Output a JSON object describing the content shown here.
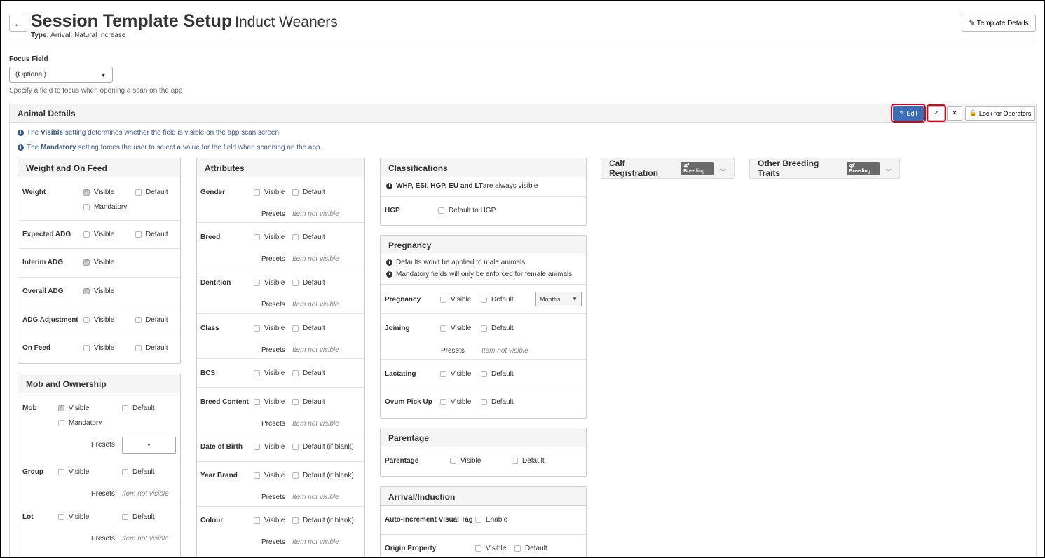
{
  "header": {
    "title": "Session Template Setup",
    "subtitle": "Induct Weaners",
    "type_label": "Type:",
    "type_value": "Arrival: Natural Increase",
    "template_details": "Template Details",
    "back": "←"
  },
  "focus": {
    "label": "Focus Field",
    "value": "(Optional)",
    "help": "Specify a field to focus when opening a scan on the app"
  },
  "panel": {
    "title": "Animal Details",
    "edit": "Edit",
    "lock": "Lock for Operators",
    "info1_pre": "The ",
    "info1_b": "Visible",
    "info1_post": " setting determines whether the field is visible on the app scan screen.",
    "info2_pre": "The ",
    "info2_b": "Mandatory",
    "info2_post": " setting forces the user to select a value for the field when scanning on the app."
  },
  "labels": {
    "visible": "Visible",
    "default": "Default",
    "mandatory": "Mandatory",
    "presets": "Presets",
    "item_not_visible": "Item not visible",
    "default_if_blank": "Default (if blank)",
    "default_to_hgp": "Default to HGP",
    "enable": "Enable",
    "months": "Months",
    "breeding": "Breeding"
  },
  "weight": {
    "title": "Weight and On Feed",
    "rows": [
      "Weight",
      "Expected ADG",
      "Interim ADG",
      "Overall ADG",
      "ADG Adjustment",
      "On Feed"
    ]
  },
  "mob": {
    "title": "Mob and Ownership",
    "rows": [
      "Mob",
      "Group",
      "Lot"
    ]
  },
  "attributes": {
    "title": "Attributes",
    "rows": [
      "Gender",
      "Breed",
      "Dentition",
      "Class",
      "BCS",
      "Breed Content",
      "Date of Birth",
      "Year Brand",
      "Colour"
    ]
  },
  "classifications": {
    "title": "Classifications",
    "note_b": "WHP, ESI, HGP, EU and LT",
    "note_post": " are always visible",
    "row": "HGP"
  },
  "pregnancy": {
    "title": "Pregnancy",
    "note1": "Defaults won't be applied to male animals",
    "note2": "Mandatory fields will only be enforced for female animals",
    "rows": [
      "Pregnancy",
      "Joining",
      "Lactating",
      "Ovum Pick Up"
    ]
  },
  "parentage": {
    "title": "Parentage",
    "row": "Parentage"
  },
  "arrival": {
    "title": "Arrival/Induction",
    "rows": [
      "Auto-increment Visual Tag",
      "Origin Property"
    ]
  },
  "calf": {
    "title": "Calf Registration"
  },
  "other": {
    "title": "Other Breeding Traits"
  }
}
